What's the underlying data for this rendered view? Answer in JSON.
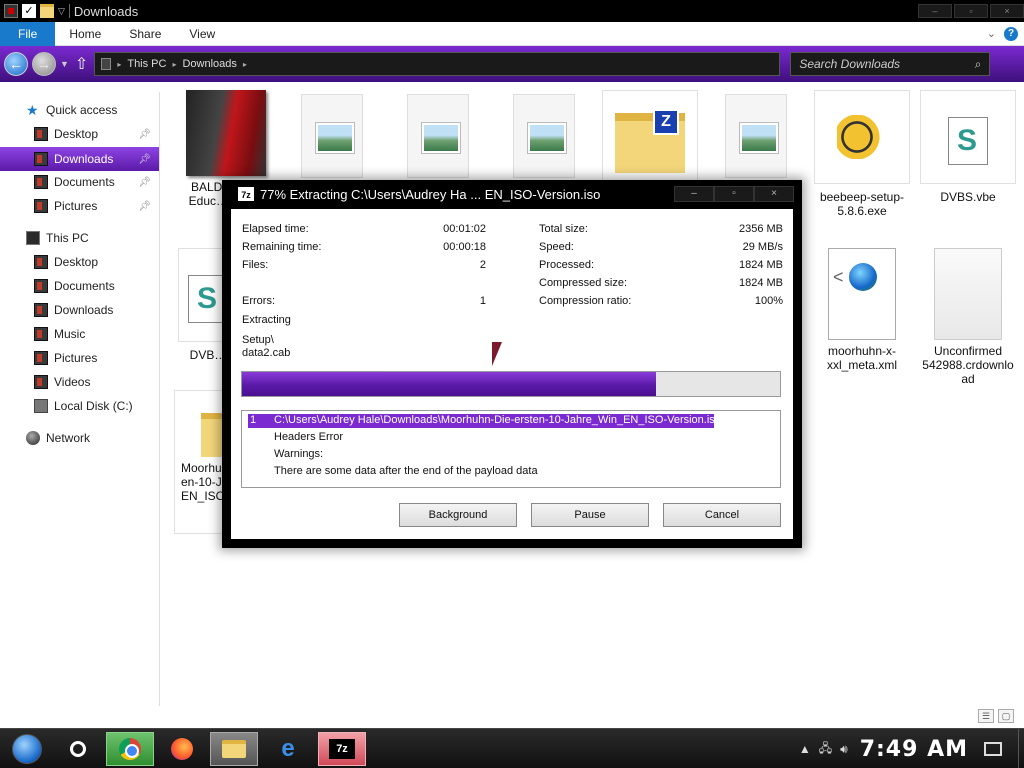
{
  "window": {
    "title": "Downloads"
  },
  "ribbon": {
    "tabs": [
      "File",
      "Home",
      "Share",
      "View"
    ]
  },
  "address": {
    "breadcrumb": [
      "This PC",
      "Downloads"
    ],
    "search_placeholder": "Search Downloads"
  },
  "nav": {
    "quick_access": "Quick access",
    "quick_items": [
      "Desktop",
      "Downloads",
      "Documents",
      "Pictures"
    ],
    "this_pc": "This PC",
    "pc_items": [
      "Desktop",
      "Documents",
      "Downloads",
      "Music",
      "Pictures",
      "Videos",
      "Local Disk (C:)"
    ],
    "network": "Network",
    "selected": "Downloads"
  },
  "files": [
    {
      "label": "BALDI b… of Educ… Lea…",
      "icon": "game-cover-icon"
    },
    {
      "label": "",
      "icon": "image-file-icon"
    },
    {
      "label": "",
      "icon": "image-file-icon"
    },
    {
      "label": "",
      "icon": "image-file-icon"
    },
    {
      "label": "",
      "icon": "zip-folder-icon"
    },
    {
      "label": "",
      "icon": "image-file-icon"
    },
    {
      "label": "beebeep-setup-5.8.6.exe",
      "icon": "bee-app-icon"
    },
    {
      "label": "DVBS.vbe",
      "icon": "script-file-icon"
    },
    {
      "label": "DVB…",
      "icon": "script-file-icon"
    },
    {
      "label": "moorhuhn-x-xxl_meta.xml",
      "icon": "xml-file-icon"
    },
    {
      "label": "Unconfirmed 542988.crdownload",
      "icon": "unconfirmed-file-icon"
    },
    {
      "label": "Moorhuh… en-10-Ja… EN_ISO-…",
      "icon": "folder-icon"
    }
  ],
  "dialog": {
    "title": "77% Extracting C:\\Users\\Audrey Ha ... EN_ISO-Version.iso",
    "app_badge": "7z",
    "left_stats": [
      {
        "label": "Elapsed time:",
        "value": "00:01:02"
      },
      {
        "label": "Remaining time:",
        "value": "00:00:18"
      },
      {
        "label": "Files:",
        "value": "2"
      },
      {
        "label": "Errors:",
        "value": "1"
      }
    ],
    "right_stats": [
      {
        "label": "Total size:",
        "value": "2356 MB"
      },
      {
        "label": "Speed:",
        "value": "29 MB/s"
      },
      {
        "label": "Processed:",
        "value": "1824 MB"
      },
      {
        "label": "Compressed size:",
        "value": "1824 MB"
      },
      {
        "label": "Compression ratio:",
        "value": "100%"
      }
    ],
    "status": "Extracting",
    "current_file_line1": "Setup\\",
    "current_file_line2": "data2.cab",
    "progress": 0.77,
    "log": {
      "index": "1",
      "path": "C:\\Users\\Audrey Hale\\Downloads\\Moorhuhn-Die-ersten-10-Jahre_Win_EN_ISO-Version.iso",
      "lines": [
        "Headers Error",
        "Warnings:",
        "There are some data after the end of the payload data"
      ]
    },
    "buttons": {
      "background": "Background",
      "pause": "Pause",
      "cancel": "Cancel"
    }
  },
  "taskbar": {
    "apps": [
      "start-orb-icon",
      "cortana-icon",
      "chrome-icon",
      "firefox-icon",
      "file-explorer-icon",
      "edge-icon",
      "7zip-icon"
    ],
    "clock": "7:49 AM"
  },
  "colors": {
    "accent": "#7a2ad0",
    "ribbon_file": "#1979ca",
    "progress": "#6a22bb"
  }
}
